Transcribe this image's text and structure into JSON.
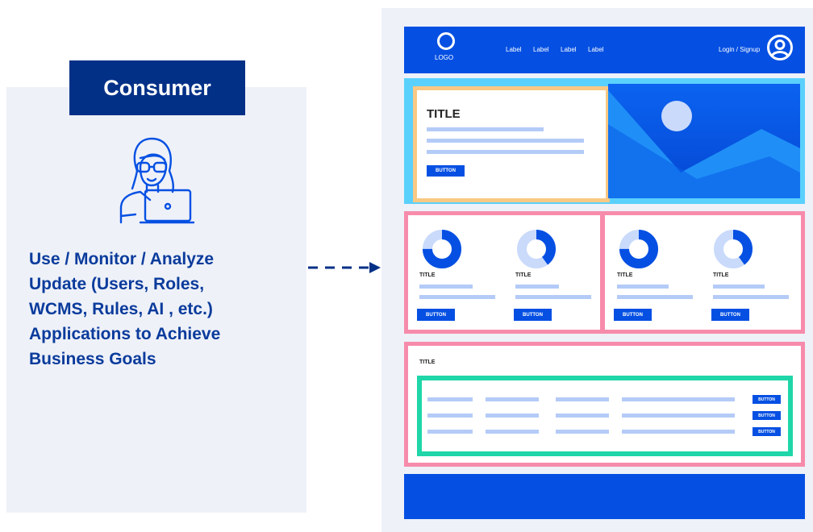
{
  "consumer": {
    "header": "Consumer",
    "description": [
      "Use / Monitor / Analyze",
      "Update (Users, Roles,",
      "WCMS, Rules, AI , etc.)",
      "Applications to Achieve",
      "Business Goals"
    ],
    "icon": "person-with-laptop-icon"
  },
  "wireframe": {
    "nav": {
      "logo_label": "LOGO",
      "links": [
        "Label",
        "Label",
        "Label",
        "Label"
      ],
      "login": "Login / Signup",
      "avatar_icon": "user-avatar-icon"
    },
    "hero": {
      "title": "TITLE",
      "button": "BUTTON",
      "image_icon": "landscape-image-icon"
    },
    "cards": [
      {
        "title": "TITLE",
        "button": "BUTTON",
        "donut_fill": 0.75
      },
      {
        "title": "TITLE",
        "button": "BUTTON",
        "donut_fill": 0.4
      },
      {
        "title": "TITLE",
        "button": "BUTTON",
        "donut_fill": 0.75
      },
      {
        "title": "TITLE",
        "button": "BUTTON",
        "donut_fill": 0.4
      }
    ],
    "list_section": {
      "title": "TITLE",
      "row_buttons": [
        "BUTTON",
        "BUTTON",
        "BUTTON"
      ]
    }
  },
  "colors": {
    "brand_blue": "#0550e3",
    "navy": "#033087",
    "text_blue": "#0a3b9c",
    "placeholder_line": "#b4cbf7",
    "hero_border": "#5ad0fc",
    "card_border": "#f9c883",
    "section_border": "#f78bab",
    "list_border": "#1fd6a8"
  }
}
